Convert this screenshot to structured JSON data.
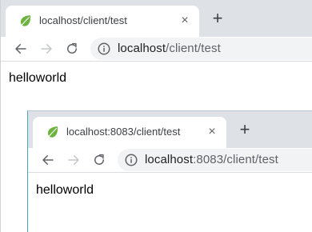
{
  "back_window": {
    "tab": {
      "favicon": "spring-leaf-icon",
      "title": "localhost/client/test",
      "close_symbol": "×"
    },
    "new_tab_symbol": "+",
    "toolbar": {
      "back_icon": "arrow-left-icon",
      "forward_icon": "arrow-right-icon",
      "reload_icon": "reload-icon",
      "site_info_icon": "info-icon",
      "url_host": "localhost",
      "url_path": "/client/test"
    },
    "page": {
      "body_text": "helloworld"
    }
  },
  "front_window": {
    "tab": {
      "favicon": "spring-leaf-icon",
      "title": "localhost:8083/client/test",
      "close_symbol": "×"
    },
    "new_tab_symbol": "+",
    "toolbar": {
      "back_icon": "arrow-left-icon",
      "forward_icon": "arrow-right-icon",
      "reload_icon": "reload-icon",
      "site_info_icon": "info-icon",
      "url_host": "localhost",
      "url_path": ":8083/client/test"
    },
    "page": {
      "body_text": "helloworld"
    }
  },
  "colors": {
    "tabstrip_bg": "#dee1e6",
    "omnibox_bg": "#f1f3f4",
    "favicon_green": "#6db33f",
    "url_dim": "#5f6368",
    "forward_disabled": "#c4c7c9"
  }
}
